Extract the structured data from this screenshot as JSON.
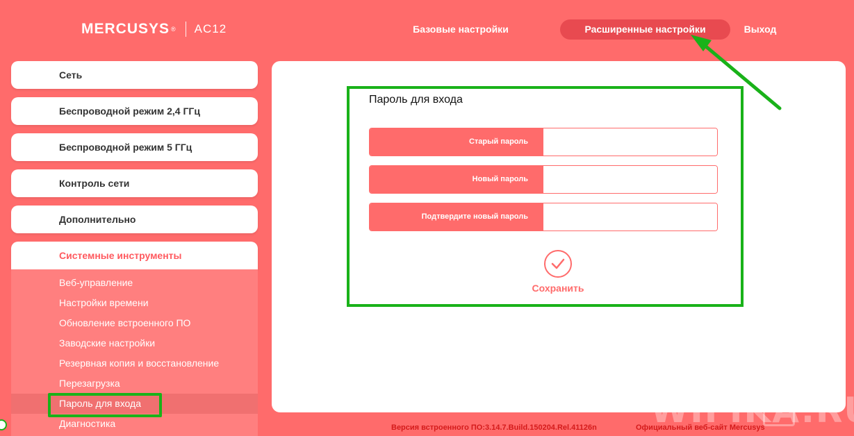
{
  "header": {
    "logo": "MERCUSYS",
    "logo_reg": "®",
    "model": "AC12",
    "nav": {
      "basic": "Базовые настройки",
      "advanced": "Расширенные настройки",
      "logout": "Выход"
    }
  },
  "sidebar": {
    "items": [
      {
        "label": "Сеть"
      },
      {
        "label": "Беспроводной режим 2,4 ГГц"
      },
      {
        "label": "Беспроводной режим 5 ГГц"
      },
      {
        "label": "Контроль сети"
      },
      {
        "label": "Дополнительно"
      },
      {
        "label": "Системные инструменты"
      }
    ],
    "submenu": [
      {
        "label": "Веб-управление"
      },
      {
        "label": "Настройки времени"
      },
      {
        "label": "Обновление встроенного ПО"
      },
      {
        "label": "Заводские настройки"
      },
      {
        "label": "Резервная копия и восстановление"
      },
      {
        "label": "Перезагрузка"
      },
      {
        "label": "Пароль для входа"
      },
      {
        "label": "Диагностика"
      }
    ]
  },
  "form": {
    "title": "Пароль для входа",
    "fields": [
      {
        "label": "Старый пароль",
        "value": ""
      },
      {
        "label": "Новый пароль",
        "value": ""
      },
      {
        "label": "Подтвердите новый пароль",
        "value": ""
      }
    ],
    "save_label": "Сохранить"
  },
  "footer": {
    "version": "Версия встроенного ПО:3.14.7.Build.150204.Rel.41126n",
    "site": "Официальный веб-сайт Mercusys"
  },
  "watermark": "WIFIKA.RU",
  "colors": {
    "background": "#ff6b6b",
    "accent_dark": "#e84a50",
    "annotation_green": "#19b219",
    "footer_text": "#d41b1b"
  }
}
